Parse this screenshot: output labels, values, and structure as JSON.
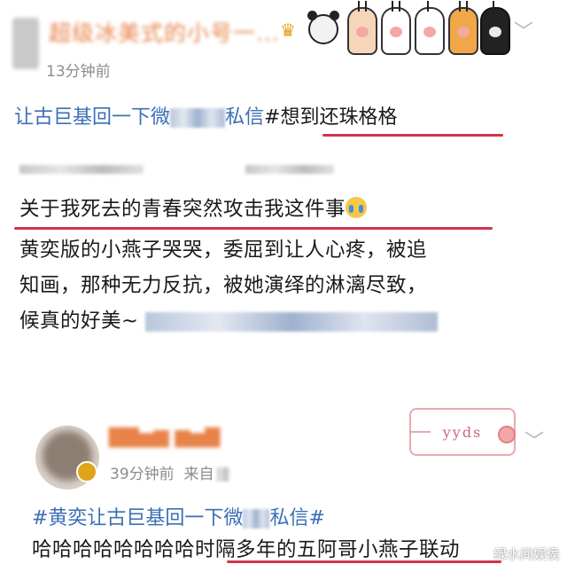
{
  "post1": {
    "username": "超级冰美式的小号一...",
    "time": "13分钟前",
    "topic_line": "#黄奕让古巨基回一下微博私信#想到还珠格格",
    "topic_prefix_visible": "让古巨基回一下微",
    "topic_private": "私信",
    "topic_second": "#想到还珠格格",
    "headline": "关于我死去的青春突然攻击我这件事",
    "body_line1": "黄奕版的小燕子哭哭，委屈到让人心疼，被追",
    "body_line2": "知画，那种无力反抗，被她演绎的淋漓尽致，",
    "body_line3": "候真的好美~"
  },
  "post2": {
    "time": "39分钟前",
    "from_label": "来自",
    "topic_a": "#黄奕让古巨基回一下微",
    "topic_b": "私信#",
    "text": "哈哈哈哈哈哈哈哈时隔多年的五阿哥小燕子联动",
    "sticker": "yyds"
  },
  "watermark": "绿水间娱侯",
  "colors": {
    "topic_blue": "#3b6fb5",
    "underline_red": "#d1344a",
    "username_orange": "#e8834a"
  },
  "icons": [
    "crown-icon",
    "panda-icon",
    "cat-paw-icons",
    "chevron-down-icon",
    "crying-face-emoji"
  ]
}
